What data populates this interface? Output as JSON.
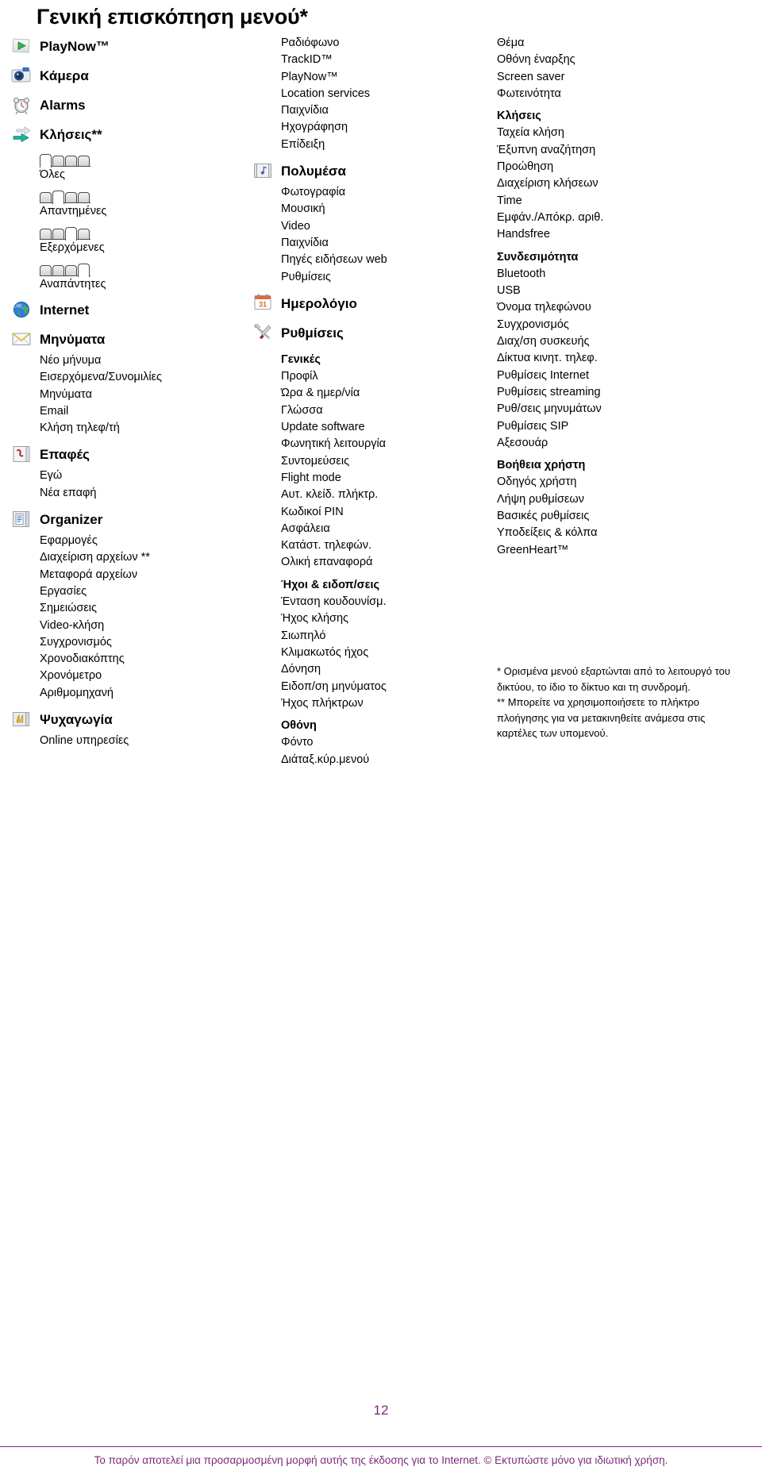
{
  "title": "Γενική επισκόπηση μενού*",
  "column1": [
    {
      "type": "group",
      "icon": "playnow-icon",
      "label": "PlayNow™",
      "items": []
    },
    {
      "type": "group",
      "icon": "camera-icon",
      "label": "Κάμερα",
      "items": []
    },
    {
      "type": "group",
      "icon": "alarm-clock-icon",
      "label": "Alarms",
      "items": []
    },
    {
      "type": "group",
      "icon": "calls-arrows-icon",
      "label": "Κλήσεις**",
      "items": []
    },
    {
      "type": "tabs",
      "icon": "call-tabs-all-icon",
      "label": "Όλες",
      "pattern": [
        0,
        1,
        1,
        1
      ]
    },
    {
      "type": "tabs",
      "icon": "call-tabs-answered-icon",
      "label": "Απαντημένες",
      "pattern": [
        1,
        0,
        1,
        1
      ]
    },
    {
      "type": "tabs",
      "icon": "call-tabs-outgoing-icon",
      "label": "Εξερχόμενες",
      "pattern": [
        1,
        1,
        0,
        1
      ]
    },
    {
      "type": "tabs",
      "icon": "call-tabs-missed-icon",
      "label": "Αναπάντητες",
      "pattern": [
        1,
        1,
        1,
        0
      ]
    },
    {
      "type": "group",
      "icon": "internet-globe-icon",
      "label": "Internet",
      "items": []
    },
    {
      "type": "group",
      "icon": "messaging-envelope-icon",
      "label": "Μηνύματα",
      "items": [
        "Νέο μήνυμα",
        "Εισερχόμενα/Συνομιλίες",
        "Μηνύματα",
        "Email",
        "Κλήση τηλεφ/τή"
      ]
    },
    {
      "type": "group",
      "icon": "contacts-icon",
      "label": "Επαφές",
      "items": [
        "Εγώ",
        "Νέα επαφή"
      ]
    },
    {
      "type": "group",
      "icon": "organizer-icon",
      "label": "Organizer",
      "items": [
        "Εφαρμογές",
        "Διαχείριση αρχείων **",
        "Μεταφορά αρχείων",
        "Εργασίες",
        "Σημειώσεις",
        "Video-κλήση",
        "Συγχρονισμός",
        "Χρονοδιακόπτης",
        "Χρονόμετρο",
        "Αριθμομηχανή"
      ]
    },
    {
      "type": "group",
      "icon": "entertainment-icon",
      "label": "Ψυχαγωγία",
      "items": [
        "Online υπηρεσίες"
      ]
    }
  ],
  "column2": [
    {
      "type": "orphan",
      "items": [
        "Ραδιόφωνο",
        "TrackID™",
        "PlayNow™",
        "Location services",
        "Παιχνίδια",
        "Ηχογράφηση",
        "Επίδειξη"
      ]
    },
    {
      "type": "group",
      "icon": "multimedia-icon",
      "label": "Πολυμέσα",
      "items": [
        "Φωτογραφία",
        "Μουσική",
        "Video",
        "Παιχνίδια",
        "Πηγές ειδήσεων web",
        "Ρυθμίσεις"
      ]
    },
    {
      "type": "group",
      "icon": "calendar-icon",
      "label": "Ημερολόγιο",
      "items": []
    },
    {
      "type": "group",
      "icon": "settings-tools-icon",
      "label": "Ρυθμίσεις",
      "items": []
    },
    {
      "type": "subhead",
      "label": "Γενικές",
      "items": [
        "Προφίλ",
        "Ώρα & ημερ/νία",
        "Γλώσσα",
        "Update software",
        "Φωνητική λειτουργία",
        "Συντομεύσεις",
        "Flight mode",
        "Αυτ. κλείδ. πλήκτρ.",
        "Κωδικοί PIN",
        "Ασφάλεια",
        "Κατάστ. τηλεφών.",
        "Ολική επαναφορά"
      ]
    },
    {
      "type": "subhead",
      "label": "Ήχοι & ειδοπ/σεις",
      "items": [
        "Ένταση κουδουνίσμ.",
        "Ήχος κλήσης",
        "Σιωπηλό",
        "Κλιμακωτός ήχος",
        "Δόνηση",
        "Ειδοπ/ση μηνύματος",
        "Ήχος πλήκτρων"
      ]
    },
    {
      "type": "subhead",
      "label": "Οθόνη",
      "items": [
        "Φόντο",
        "Διάταξ.κύρ.μενού"
      ]
    }
  ],
  "column3": [
    {
      "type": "orphan",
      "items": [
        "Θέμα",
        "Οθόνη έναρξης",
        "Screen saver",
        "Φωτεινότητα"
      ]
    },
    {
      "type": "subhead",
      "label": "Κλήσεις",
      "items": [
        "Ταχεία κλήση",
        "Έξυπνη αναζήτηση",
        "Προώθηση",
        "Διαχείριση κλήσεων",
        "Time",
        "Εμφάν./Απόκρ. αριθ.",
        "Handsfree"
      ]
    },
    {
      "type": "subhead",
      "label": "Συνδεσιμότητα",
      "items": [
        "Bluetooth",
        "USB",
        "Όνομα τηλεφώνου",
        "Συγχρονισμός",
        "Διαχ/ση συσκευής",
        "Δίκτυα κινητ. τηλεφ.",
        "Ρυθμίσεις Internet",
        "Ρυθμίσεις streaming",
        "Ρυθ/σεις μηνυμάτων",
        "Ρυθμίσεις SIP",
        "Αξεσουάρ"
      ]
    },
    {
      "type": "subhead",
      "label": "Βοήθεια χρήστη",
      "items": [
        "Οδηγός χρήστη",
        "Λήψη ρυθμίσεων",
        "Βασικές ρυθμίσεις",
        "Υποδείξεις & κόλπα",
        "GreenHeart™"
      ]
    }
  ],
  "footnotes": [
    "* Ορισμένα μενού εξαρτώνται από το λειτουργό του δικτύου, το ίδιο το δίκτυο και τη συνδρομή.",
    "** Μπορείτε να χρησιμοποιήσετε το πλήκτρο πλοήγησης για να μετακινηθείτε ανάμεσα στις καρτέλες των υπομενού."
  ],
  "page_number": "12",
  "footer_text": "Το παρόν αποτελεί μια προσαρμοσμένη μορφή αυτής της έκδοσης για το Internet. © Εκτυπώστε μόνο για ιδιωτική χρήση.",
  "colors": {
    "footer_purple": "#7b2a7b",
    "rule_purple": "#8d1b8d",
    "text": "#000000"
  }
}
